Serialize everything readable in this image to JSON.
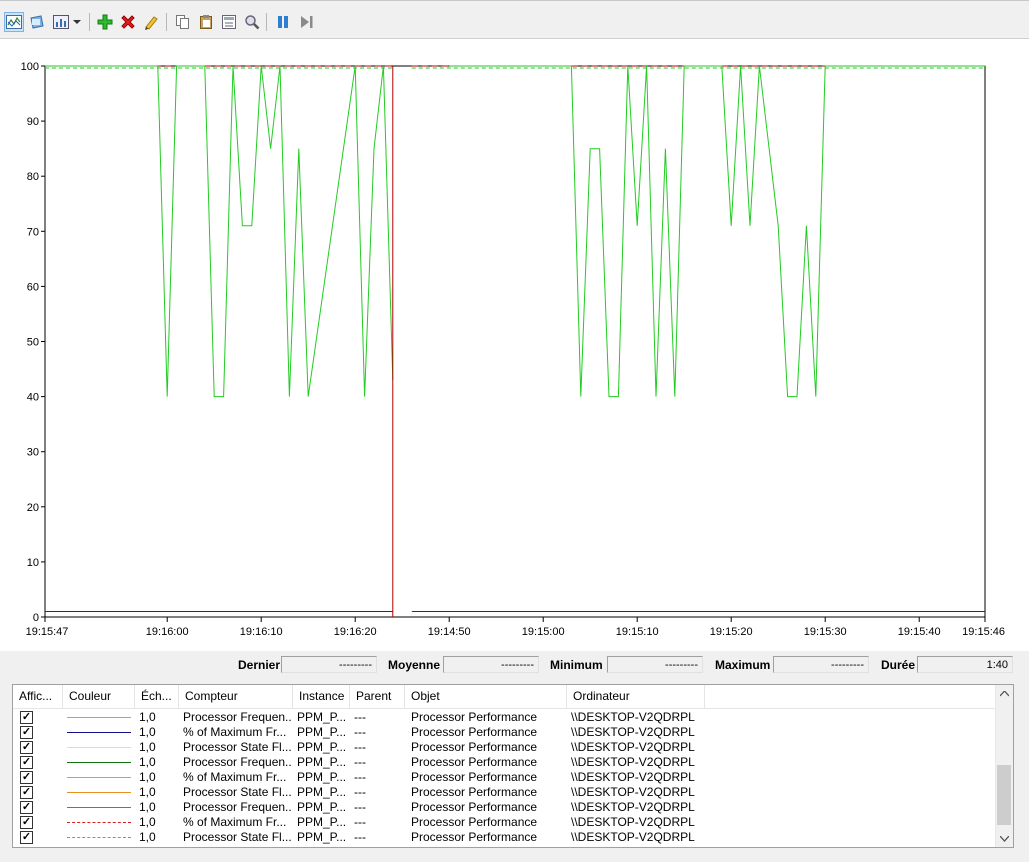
{
  "toolbar": {
    "buttons": [
      {
        "icon": "view-graph-icon",
        "active": true
      },
      {
        "icon": "freeze-display-icon"
      },
      {
        "icon": "change-graph-type-icon"
      },
      {
        "icon": "add-counter-icon"
      },
      {
        "icon": "delete-counter-icon"
      },
      {
        "icon": "highlight-icon"
      },
      {
        "icon": "copy-properties-icon"
      },
      {
        "icon": "paste-counter-list-icon"
      },
      {
        "icon": "properties-icon"
      },
      {
        "icon": "zoom-icon"
      },
      {
        "icon": "freeze-icon"
      },
      {
        "icon": "update-data-icon"
      }
    ]
  },
  "chart_data": {
    "type": "line",
    "ylim": [
      0,
      100
    ],
    "y_ticks": [
      "100",
      "90",
      "80",
      "70",
      "60",
      "50",
      "40",
      "30",
      "20",
      "10",
      "0"
    ],
    "x_ticks": [
      "19:15:47",
      "19:16:00",
      "19:16:10",
      "19:16:20",
      "19:14:50",
      "19:15:00",
      "19:15:10",
      "19:15:20",
      "19:15:30",
      "19:15:40",
      "19:15:46"
    ],
    "grid": false,
    "series": [
      {
        "color": "#1e1ec8",
        "style": "solid",
        "values": [
          1,
          1
        ]
      },
      {
        "color": "#c00000",
        "style": "dashed",
        "values": [
          100,
          100
        ]
      },
      {
        "color": "#22cc22",
        "style": "solid",
        "points": [
          [
            "19:15:47",
            100
          ],
          [
            "19:15:59",
            100
          ],
          [
            "19:16:00",
            40
          ],
          [
            "19:16:01",
            100
          ],
          [
            "19:16:03",
            100
          ],
          [
            "19:16:04",
            100
          ],
          [
            "19:16:05",
            40
          ],
          [
            "19:16:06",
            40
          ],
          [
            "19:16:07",
            100
          ],
          [
            "19:16:08",
            71
          ],
          [
            "19:16:09",
            71
          ],
          [
            "19:16:10",
            100
          ],
          [
            "19:16:11",
            85
          ],
          [
            "19:16:12",
            100
          ],
          [
            "19:16:13",
            40
          ],
          [
            "19:16:14",
            85
          ],
          [
            "19:16:15",
            40
          ],
          [
            "19:16:20",
            100
          ],
          [
            "19:16:21",
            40
          ],
          [
            "19:16:22",
            85
          ],
          [
            "19:16:23",
            100
          ],
          [
            "19:16:24",
            43
          ],
          [
            "19:14:50",
            100
          ],
          [
            "19:15:03",
            100
          ],
          [
            "19:15:04",
            40
          ],
          [
            "19:15:05",
            85
          ],
          [
            "19:15:06",
            85
          ],
          [
            "19:15:07",
            40
          ],
          [
            "19:15:08",
            40
          ],
          [
            "19:15:09",
            100
          ],
          [
            "19:15:10",
            71
          ],
          [
            "19:15:11",
            100
          ],
          [
            "19:15:12",
            40
          ],
          [
            "19:15:13",
            85
          ],
          [
            "19:15:14",
            40
          ],
          [
            "19:15:15",
            100
          ],
          [
            "19:15:19",
            100
          ],
          [
            "19:15:20",
            71
          ],
          [
            "19:15:21",
            100
          ],
          [
            "19:15:22",
            71
          ],
          [
            "19:15:23",
            100
          ],
          [
            "19:15:25",
            71
          ],
          [
            "19:15:26",
            40
          ],
          [
            "19:15:27",
            40
          ],
          [
            "19:15:28",
            71
          ],
          [
            "19:15:29",
            40
          ],
          [
            "19:15:30",
            100
          ]
        ]
      }
    ]
  },
  "stats": {
    "last_label": "Dernier",
    "last_value": "---------",
    "avg_label": "Moyenne",
    "avg_value": "---------",
    "min_label": "Minimum",
    "min_value": "---------",
    "max_label": "Maximum",
    "max_value": "---------",
    "dur_label": "Durée",
    "dur_value": "1:40"
  },
  "list": {
    "headers": [
      "Affic...",
      "Couleur",
      "Éch...",
      "Compteur",
      "Instance",
      "Parent",
      "Objet",
      "Ordinateur"
    ],
    "rows": [
      {
        "color": "#40c8e8",
        "style": "solid",
        "scale": "1,0",
        "counter": "Processor Frequen...",
        "instance": "PPM_P...",
        "parent": "---",
        "object": "Processor Performance",
        "computer": "\\\\DESKTOP-V2QDRPL"
      },
      {
        "color": "#10108a",
        "style": "solid",
        "scale": "1,0",
        "counter": "% of Maximum Fr...",
        "instance": "PPM_P...",
        "parent": "---",
        "object": "Processor Performance",
        "computer": "\\\\DESKTOP-V2QDRPL"
      },
      {
        "color": "#f0d8b0",
        "style": "solid",
        "scale": "1,0",
        "counter": "Processor State Fl...",
        "instance": "PPM_P...",
        "parent": "---",
        "object": "Processor Performance",
        "computer": "\\\\DESKTOP-V2QDRPL"
      },
      {
        "color": "#107010",
        "style": "solid",
        "scale": "1,0",
        "counter": "Processor Frequen...",
        "instance": "PPM_P...",
        "parent": "---",
        "object": "Processor Performance",
        "computer": "\\\\DESKTOP-V2QDRPL"
      },
      {
        "color": "#60c8a8",
        "style": "solid",
        "scale": "1,0",
        "counter": "% of Maximum Fr...",
        "instance": "PPM_P...",
        "parent": "---",
        "object": "Processor Performance",
        "computer": "\\\\DESKTOP-V2QDRPL"
      },
      {
        "color": "#e89020",
        "style": "solid",
        "scale": "1,0",
        "counter": "Processor State Fl...",
        "instance": "PPM_P...",
        "parent": "---",
        "object": "Processor Performance",
        "computer": "\\\\DESKTOP-V2QDRPL"
      },
      {
        "color": "#808000",
        "style": "solid",
        "scale": "1,0",
        "counter": "Processor Frequen...",
        "instance": "PPM_P...",
        "parent": "---",
        "object": "Processor Performance",
        "computer": "\\\\DESKTOP-V2QDRPL"
      },
      {
        "color": "#d02020",
        "style": "dashed",
        "scale": "1,0",
        "counter": "% of Maximum Fr...",
        "instance": "PPM_P...",
        "parent": "---",
        "object": "Processor Performance",
        "computer": "\\\\DESKTOP-V2QDRPL"
      },
      {
        "color": "#30d030",
        "style": "dashed",
        "scale": "1,0",
        "counter": "Processor State Fl...",
        "instance": "PPM_P...",
        "parent": "---",
        "object": "Processor Performance",
        "computer": "\\\\DESKTOP-V2QDRPL"
      }
    ]
  }
}
